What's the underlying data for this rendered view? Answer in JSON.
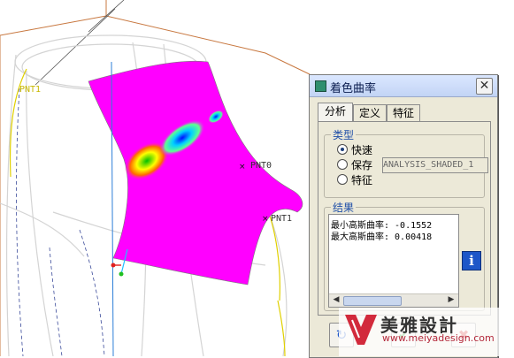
{
  "viewport": {
    "datum_labels": [
      "PNT1",
      "PNT0",
      "PNT1"
    ],
    "colors": {
      "surface": "#ff00ff",
      "wire": "#d8d8d8",
      "datum": "#e0d000",
      "frame": "#c87840"
    }
  },
  "dialog": {
    "title": "着色曲率",
    "tabs": [
      "分析",
      "定义",
      "特征"
    ],
    "type_group": {
      "legend": "类型",
      "options": [
        "快速",
        "保存",
        "特征"
      ],
      "selected": "快速",
      "name_field": "ANALYSIS_SHADED_1"
    },
    "results_group": {
      "legend": "结果",
      "lines": [
        "最小高斯曲率: -0.1552",
        "最大高斯曲率: 0.00418"
      ]
    },
    "icons": {
      "title": "dialog-app-icon",
      "close": "close-icon",
      "info": "info-icon",
      "repeat": "repeat-icon",
      "ok": "checkmark-icon",
      "cancel": "cancel-x-icon"
    },
    "info_label": "i"
  },
  "watermark": {
    "title": "美雅設計",
    "url": "www.meiyadesign.com"
  }
}
